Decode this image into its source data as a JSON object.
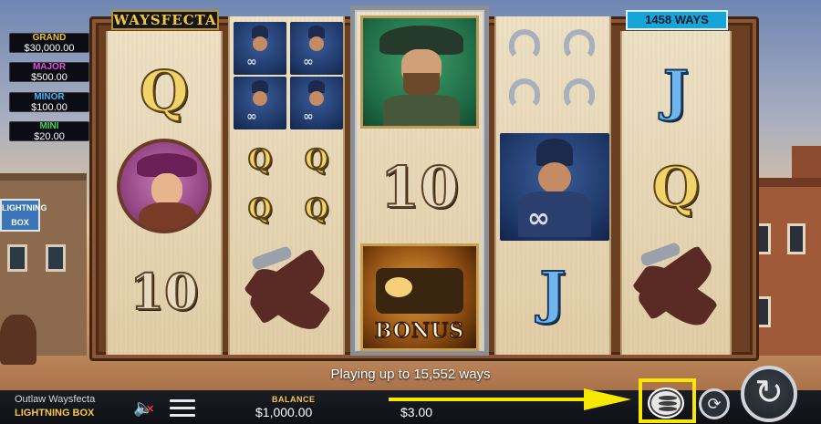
{
  "jackpots": [
    {
      "label": "GRAND",
      "amount": "$30,000.00",
      "color": "#e8c23a"
    },
    {
      "label": "MAJOR",
      "amount": "$500.00",
      "color": "#e24fd6"
    },
    {
      "label": "MINOR",
      "amount": "$100.00",
      "color": "#40b8f0"
    },
    {
      "label": "MINI",
      "amount": "$20.00",
      "color": "#43d65a"
    }
  ],
  "reels_banner": {
    "left": "WAYSFECTA",
    "right": "1458 WAYS"
  },
  "symbols": {
    "reel1": {
      "top": "Q",
      "bottom": "10"
    },
    "reel3": {
      "middle": "10",
      "bonus": "BONUS"
    },
    "reel4": {
      "bottom": "J"
    },
    "reel5": {
      "top": "J",
      "middle": "Q"
    },
    "reel2": {
      "q": "Q"
    }
  },
  "scene": {
    "sign": "LIGHTNING BOX"
  },
  "status_message": "Playing up to 15,552 ways",
  "bottom_bar": {
    "game_name": "Outlaw Waysfecta",
    "brand_main": "LIGHTNING BOX",
    "balance_label": "BALANCE",
    "balance_value": "$1,000.00",
    "bet_value": "$3.00"
  },
  "icons": {
    "mute": "speaker-muted-icon",
    "menu": "hamburger-menu-icon",
    "coin": "coin-stack-icon",
    "autoplay": "autoplay-icon",
    "spin": "spin-icon"
  },
  "colors": {
    "highlight": "#f7e800",
    "accent_gold": "#f5c64a"
  }
}
